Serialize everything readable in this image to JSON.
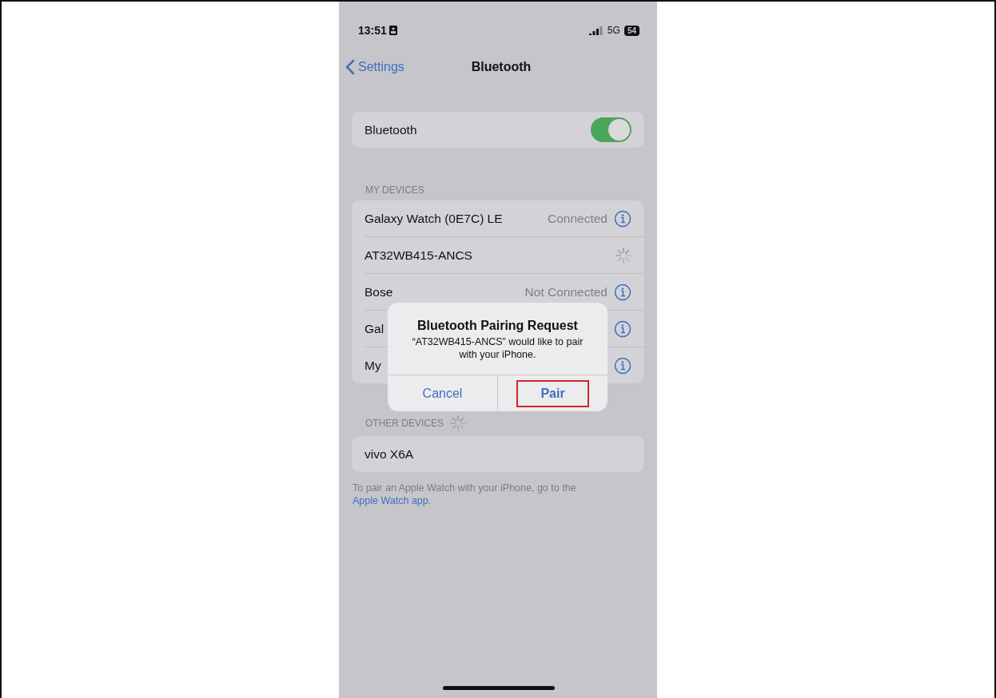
{
  "status_bar": {
    "time": "13:51",
    "network": "5G",
    "battery": "54"
  },
  "nav": {
    "back": "Settings",
    "title": "Bluetooth"
  },
  "bluetooth_switch": {
    "label": "Bluetooth",
    "on": true
  },
  "my_devices": {
    "header": "MY DEVICES",
    "devices": [
      {
        "name": "Galaxy Watch (0E7C) LE",
        "status": "Connected",
        "kind": "info"
      },
      {
        "name": "AT32WB415-ANCS",
        "kind": "spinner"
      },
      {
        "name": "Bose",
        "status": "Not Connected",
        "kind": "info"
      },
      {
        "name": "Gal",
        "kind": "info"
      },
      {
        "name": "My",
        "kind": "info"
      }
    ]
  },
  "other_devices": {
    "header": "OTHER DEVICES",
    "searching": true,
    "devices": [
      {
        "name": "vivo X6A"
      }
    ]
  },
  "footer": {
    "text": "To pair an Apple Watch with your iPhone, go to the",
    "link": "Apple Watch app",
    "after": "."
  },
  "dialog": {
    "title": "Bluetooth Pairing Request",
    "message": "“AT32WB415-ANCS” would like to pair with your iPhone.",
    "buttons": [
      {
        "label": "Cancel",
        "kind": "normal",
        "highlighted": false
      },
      {
        "label": "Pair",
        "kind": "bold",
        "highlighted": true
      }
    ]
  }
}
